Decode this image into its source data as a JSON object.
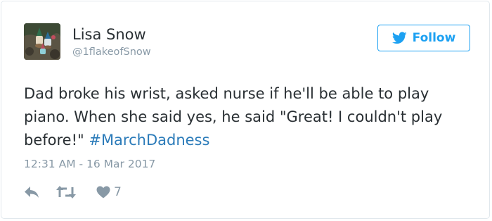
{
  "user": {
    "name": "Lisa Snow",
    "handle": "@1flakeofSnow",
    "avatar_icon": "garden-gnome-avatar"
  },
  "follow_button": {
    "icon": "twitter-bird-icon",
    "label": "Follow"
  },
  "tweet": {
    "text": "Dad broke his wrist, asked nurse if he'll be able to play piano. When she said yes, he said \"Great! I couldn't play before!\" ",
    "hashtag": "#MarchDadness",
    "timestamp": "12:31 AM - 16 Mar 2017"
  },
  "actions": {
    "reply_icon": "reply-icon",
    "retweet_icon": "retweet-icon",
    "like_icon": "heart-icon",
    "like_count": "7"
  },
  "colors": {
    "accent": "#1da1f2",
    "hashtag": "#2b7bb9",
    "text": "#292f33",
    "muted": "#8899a6",
    "border": "#e1e8ed"
  }
}
